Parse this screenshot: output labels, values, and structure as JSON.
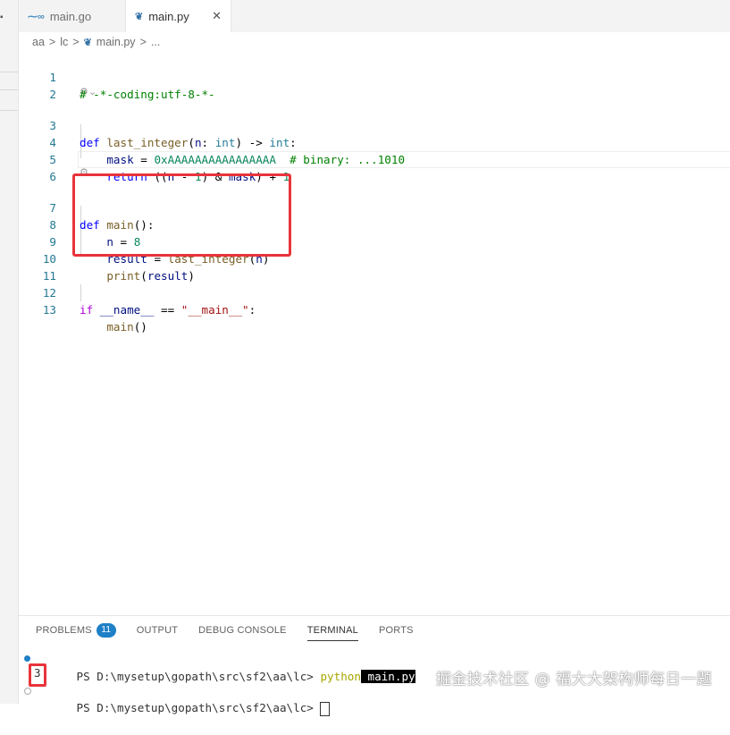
{
  "tabs": [
    {
      "icon": "go-file-icon",
      "label": "main.go",
      "active": false
    },
    {
      "icon": "python-file-icon",
      "label": "main.py",
      "active": true
    }
  ],
  "tab_close_glyph": "✕",
  "breadcrumb": {
    "parts": [
      "aa",
      "lc",
      "main.py",
      "..."
    ],
    "separator": ">"
  },
  "code_lines": [
    {
      "n": "1",
      "text": "# -*-coding:utf-8-*-"
    },
    {
      "n": "2",
      "text": ""
    },
    {
      "n": "3",
      "text": "def last_integer(n: int) -> int:"
    },
    {
      "n": "4",
      "text": "    mask = 0xAAAAAAAAAAAAAAAA  # binary: ...1010"
    },
    {
      "n": "5",
      "text": "    return ((n - 1) & mask) + 1"
    },
    {
      "n": "6",
      "text": ""
    },
    {
      "n": "7",
      "text": "def main():"
    },
    {
      "n": "8",
      "text": "    n = 8"
    },
    {
      "n": "9",
      "text": "    result = last_integer(n)"
    },
    {
      "n": "10",
      "text": "    print(result)"
    },
    {
      "n": "11",
      "text": ""
    },
    {
      "n": "12",
      "text": "if __name__ == \"__main__\":"
    },
    {
      "n": "13",
      "text": "    main()"
    }
  ],
  "panel": {
    "tabs": [
      {
        "label": "PROBLEMS",
        "badge": "11"
      },
      {
        "label": "OUTPUT"
      },
      {
        "label": "DEBUG CONSOLE"
      },
      {
        "label": "TERMINAL",
        "active": true
      },
      {
        "label": "PORTS"
      }
    ]
  },
  "terminal": {
    "prompt1": "PS D:\\mysetup\\gopath\\src\\sf2\\aa\\lc> ",
    "command": "python",
    "arg": " main.py",
    "output": "3",
    "prompt2": "PS D:\\mysetup\\gopath\\src\\sf2\\aa\\lc> "
  },
  "watermark": "掘金技术社区 @ 福大大架构师每日一题",
  "colors": {
    "highlight_box": "#e8343b",
    "line_number": "#237893",
    "keyword": "#0000ff",
    "function": "#795e26",
    "badge": "#1e80c6"
  }
}
